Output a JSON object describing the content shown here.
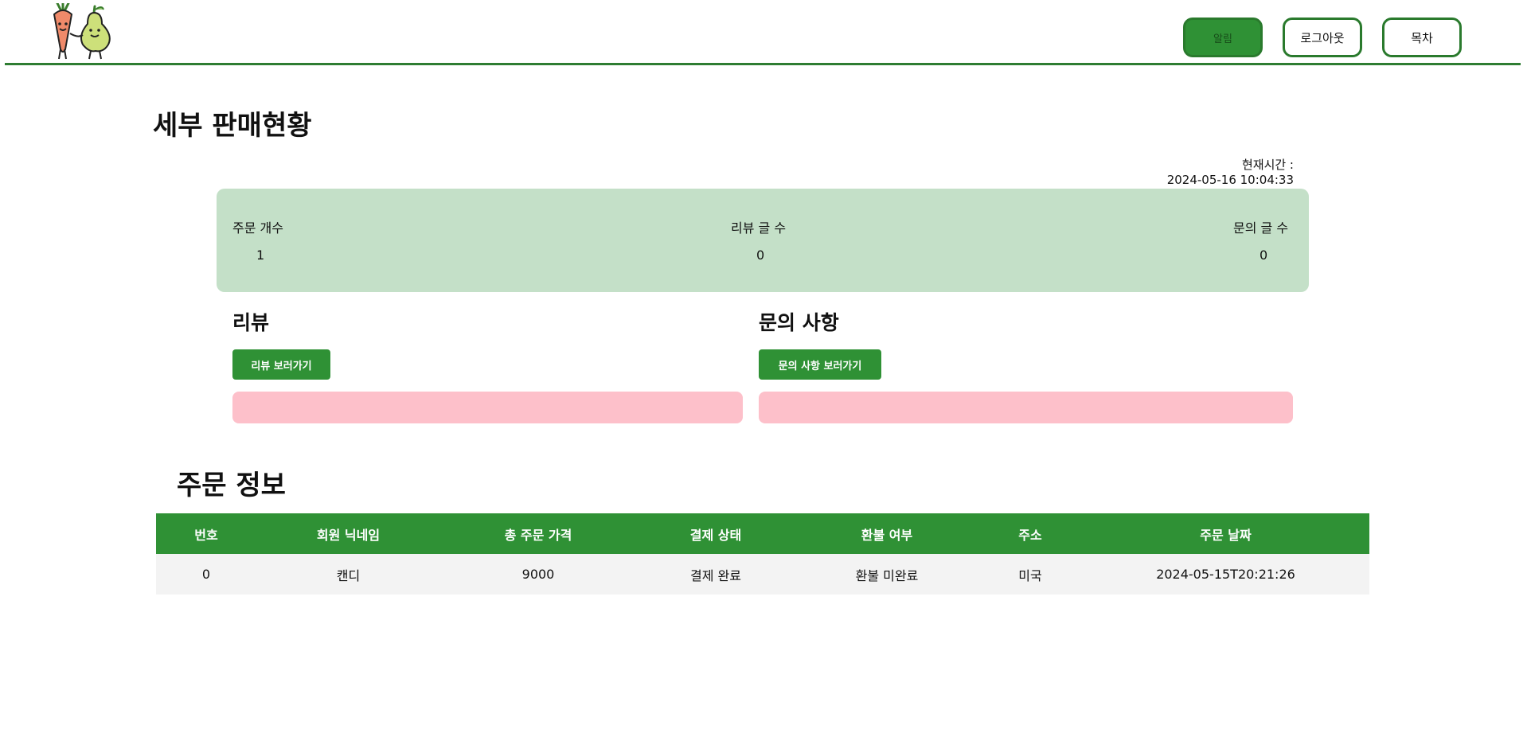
{
  "header": {
    "logo": "carrot-and-pear-logo",
    "alarm_label": "알림",
    "logout_label": "로그아웃",
    "menu_label": "목차"
  },
  "page_title": "세부 판매현황",
  "time": {
    "label": "현재시간 :",
    "value": "2024-05-16 10:04:33"
  },
  "stats": {
    "orders_label": "주문 개수",
    "orders_value": "1",
    "reviews_label": "리뷰 글 수",
    "reviews_value": "0",
    "inquiries_label": "문의 글 수",
    "inquiries_value": "0"
  },
  "review": {
    "title": "리뷰",
    "button": "리뷰 보러가기"
  },
  "inquiry": {
    "title": "문의 사항",
    "button": "문의 사항 보러가기"
  },
  "orders": {
    "title": "주문 정보",
    "columns": [
      "번호",
      "회원 닉네임",
      "총 주문 가격",
      "결제 상태",
      "환불 여부",
      "주소",
      "주문 날짜"
    ],
    "rows": [
      [
        "0",
        "캔디",
        "9000",
        "결제 완료",
        "환불 미완료",
        "미국",
        "2024-05-15T20:21:26"
      ]
    ]
  },
  "colors": {
    "accent_green": "#2f9135",
    "stats_bg": "#c4e0c8",
    "pink_box": "#fdc0ca"
  }
}
